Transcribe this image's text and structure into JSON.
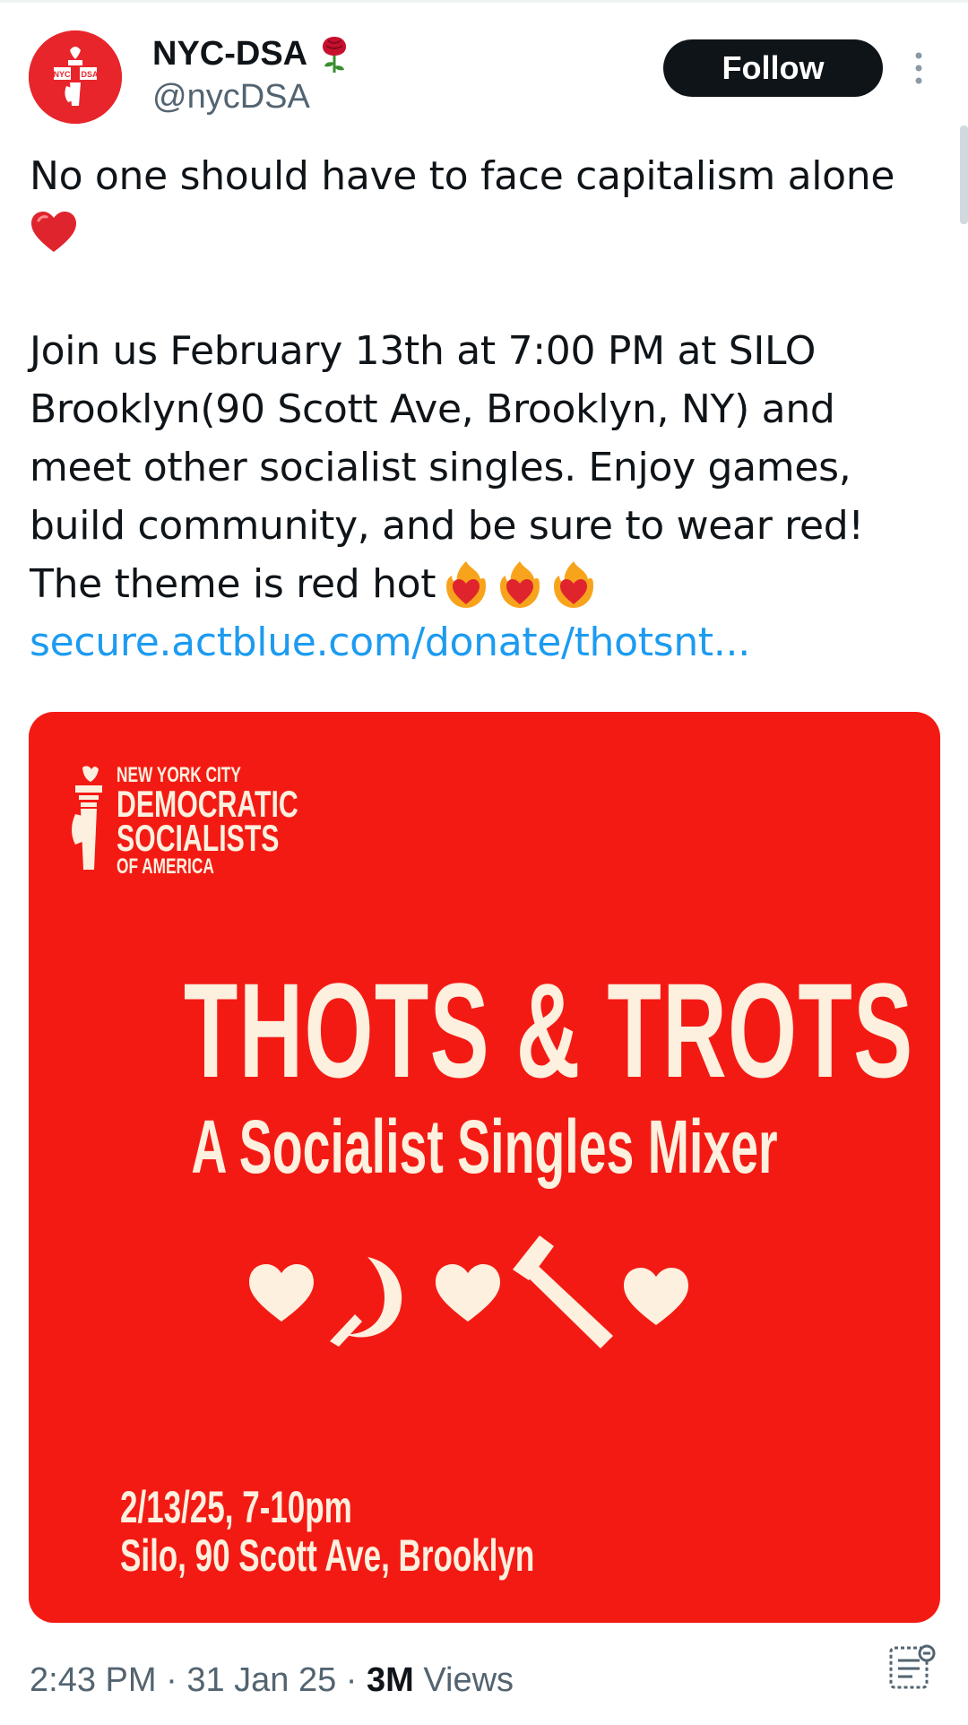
{
  "author": {
    "display_name": "NYC-DSA",
    "handle": "@nycDSA",
    "avatar_left": "NYC",
    "avatar_right": "DSA"
  },
  "follow_label": "Follow",
  "tweet": {
    "line1": "No one should have to face capitalism alone",
    "p2_lines": [
      "Join us February 13th at 7:00 PM at SILO",
      "Brooklyn(90 Scott Ave, Brooklyn, NY) and",
      "meet other socialist singles. Enjoy games,",
      "build community, and be sure to wear red!",
      "The theme is red hot"
    ],
    "link": "secure.actblue.com/donate/thotsnt..."
  },
  "poster": {
    "logo_line1": "NEW YORK CITY",
    "logo_line2": "DEMOCRATIC",
    "logo_line3": "SOCIALISTS",
    "logo_line4": "OF AMERICA",
    "title": "THOTS & TROTS",
    "subtitle": "A Socialist Singles Mixer",
    "date_line": "2/13/25, 7-10pm",
    "venue_line": "Silo, 90 Scott Ave, Brooklyn"
  },
  "meta": {
    "time": "2:43 PM",
    "separator": " · ",
    "date": "31 Jan 25",
    "views_count": "3M",
    "views_label": " Views"
  },
  "colors": {
    "poster_red": "#f41a14",
    "avatar_red": "#e8252b",
    "poster_cream": "#fdf0df",
    "link_blue": "#1d9bf0",
    "muted_gray": "#536471"
  },
  "icons": [
    "rose-icon",
    "more-icon",
    "heart-icon",
    "fire-heart-icon",
    "torch-icon",
    "sickle-icon",
    "hammer-icon",
    "analytics-icon"
  ]
}
